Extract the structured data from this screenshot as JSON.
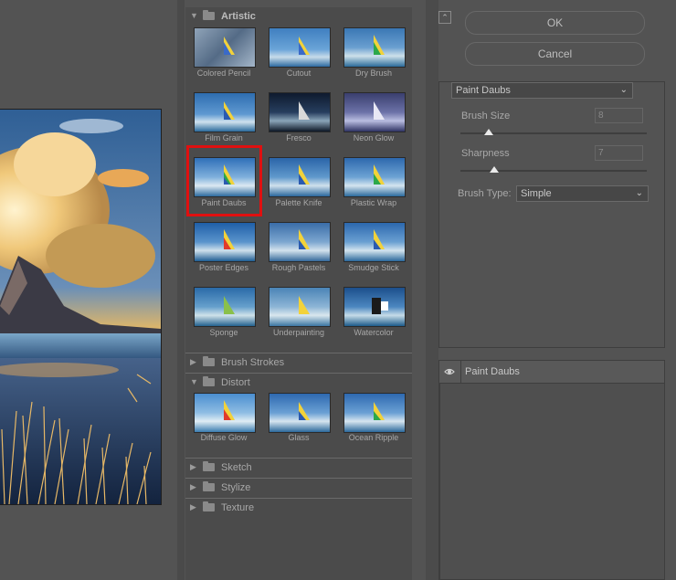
{
  "preview": {
    "image": "mountain-beach-sunset"
  },
  "gallery": {
    "categories": {
      "artistic": "Artistic",
      "brush_strokes": "Brush Strokes",
      "distort": "Distort",
      "sketch": "Sketch",
      "stylize": "Stylize",
      "texture": "Texture"
    },
    "artistic_filters": [
      "Colored Pencil",
      "Cutout",
      "Dry Brush",
      "Film Grain",
      "Fresco",
      "Neon Glow",
      "Paint Daubs",
      "Palette Knife",
      "Plastic Wrap",
      "Poster Edges",
      "Rough Pastels",
      "Smudge Stick",
      "Sponge",
      "Underpainting",
      "Watercolor"
    ],
    "distort_filters": [
      "Diffuse Glow",
      "Glass",
      "Ocean Ripple"
    ],
    "selected": "Paint Daubs"
  },
  "buttons": {
    "ok": "OK",
    "cancel": "Cancel"
  },
  "settings": {
    "filter_select": "Paint Daubs",
    "brush_size_label": "Brush Size",
    "brush_size_value": "8",
    "brush_size_level": 0.15,
    "sharpness_label": "Sharpness",
    "sharpness_value": "7",
    "sharpness_level": 0.18,
    "brush_type_label": "Brush Type:",
    "brush_type_value": "Simple"
  },
  "layers": {
    "active_layer": "Paint Daubs"
  },
  "colors": {
    "selection_highlight": "#e01010",
    "background": "#535353"
  }
}
